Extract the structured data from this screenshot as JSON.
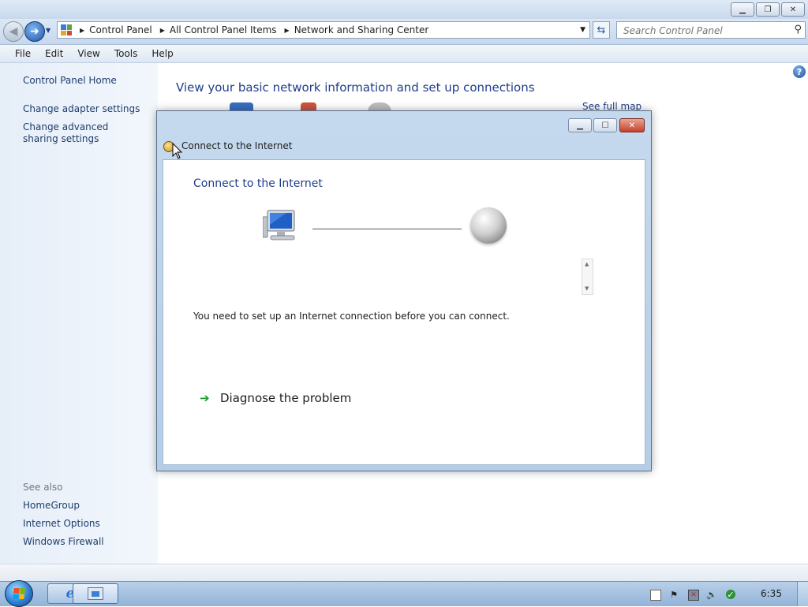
{
  "colors": {
    "link": "#1e3d6e",
    "heading": "#1e3e8c",
    "close_red": "#c7402a",
    "diagnose_arrow": "#1f9a2e"
  },
  "window": {
    "caption_buttons": {
      "minimize": "minimize-icon",
      "restore": "restore-icon",
      "close": "close-icon"
    }
  },
  "nav": {
    "back_icon": "back-arrow-icon",
    "forward_icon": "forward-arrow-icon",
    "breadcrumbs": [
      "Control Panel",
      "All Control Panel Items",
      "Network and Sharing Center"
    ],
    "search_placeholder": "Search Control Panel"
  },
  "menu": [
    "File",
    "Edit",
    "View",
    "Tools",
    "Help"
  ],
  "sidebar": {
    "home": "Control Panel Home",
    "links": [
      "Change adapter settings",
      "Change advanced sharing settings"
    ],
    "see_also_label": "See also",
    "see_also": [
      "HomeGroup",
      "Internet Options",
      "Windows Firewall"
    ]
  },
  "main": {
    "title": "View your basic network information and set up connections",
    "see_full_map": "See full map"
  },
  "dialog": {
    "title": "Connect to the Internet",
    "heading": "Connect to the Internet",
    "message": "You need to set up an Internet connection before you can connect.",
    "diagnose": "Diagnose the problem"
  },
  "taskbar": {
    "clock": "6:35",
    "tray_icons": [
      "action-center-icon",
      "flag-icon",
      "network-error-icon",
      "volume-muted-icon",
      "security-icon"
    ]
  }
}
